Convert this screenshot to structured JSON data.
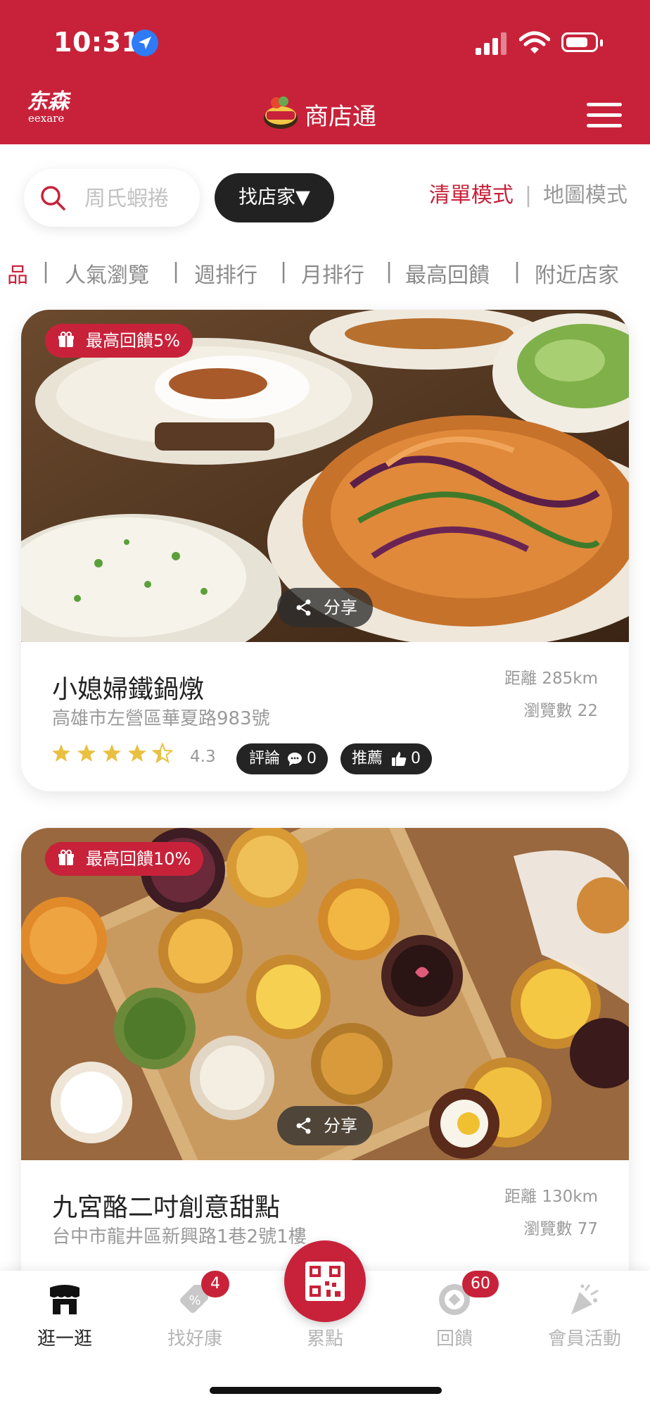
{
  "status_bar": {
    "time": "10:31"
  },
  "header": {
    "brand_logo_line1": "东森",
    "brand_logo_line2": "eexare",
    "app_mark_text": "商店通",
    "title": "商店通"
  },
  "search": {
    "input_value": "周氏蝦捲",
    "find_store_label": "找店家▼"
  },
  "view_modes": {
    "list": "清單模式",
    "separator": "|",
    "map": "地圖模式"
  },
  "category_tabs": [
    "品",
    "人氣瀏覽",
    "週排行",
    "月排行",
    "最高回饋",
    "附近店家"
  ],
  "category_separator": "|",
  "share_label": "分享",
  "stores": [
    {
      "rebate": "最高回饋5%",
      "name": "小媳婦鐵鍋燉",
      "address": "高雄市左營區華夏路983號",
      "distance": "距離 285km",
      "views": "瀏覽數 22",
      "rating": "4.3",
      "rating_value": 4.3,
      "reviews_label": "評論",
      "reviews_count": "0",
      "recommend_label": "推薦",
      "recommend_count": "0",
      "image_desc": "food-platter"
    },
    {
      "rebate": "最高回饋10%",
      "name": "九宮酪二吋創意甜點",
      "address": "台中市龍井區新興路1巷2號1樓",
      "distance": "距離 130km",
      "views": "瀏覽數 77",
      "image_desc": "dessert-tarts"
    }
  ],
  "bottom_nav": {
    "items": [
      {
        "label": "逛一逛",
        "icon": "store-icon",
        "active": true
      },
      {
        "label": "找好康",
        "icon": "discount-tag-icon",
        "badge": "4"
      },
      {
        "label": "累點",
        "icon": "qr-code-icon"
      },
      {
        "label": "回饋",
        "icon": "coin-icon",
        "badge": "60"
      },
      {
        "label": "會員活動",
        "icon": "party-popper-icon"
      }
    ]
  },
  "colors": {
    "brand_red": "#c8223a",
    "dark_pill": "#242424",
    "star_yellow": "#e8c042",
    "text_gray": "#9a9a9a"
  }
}
